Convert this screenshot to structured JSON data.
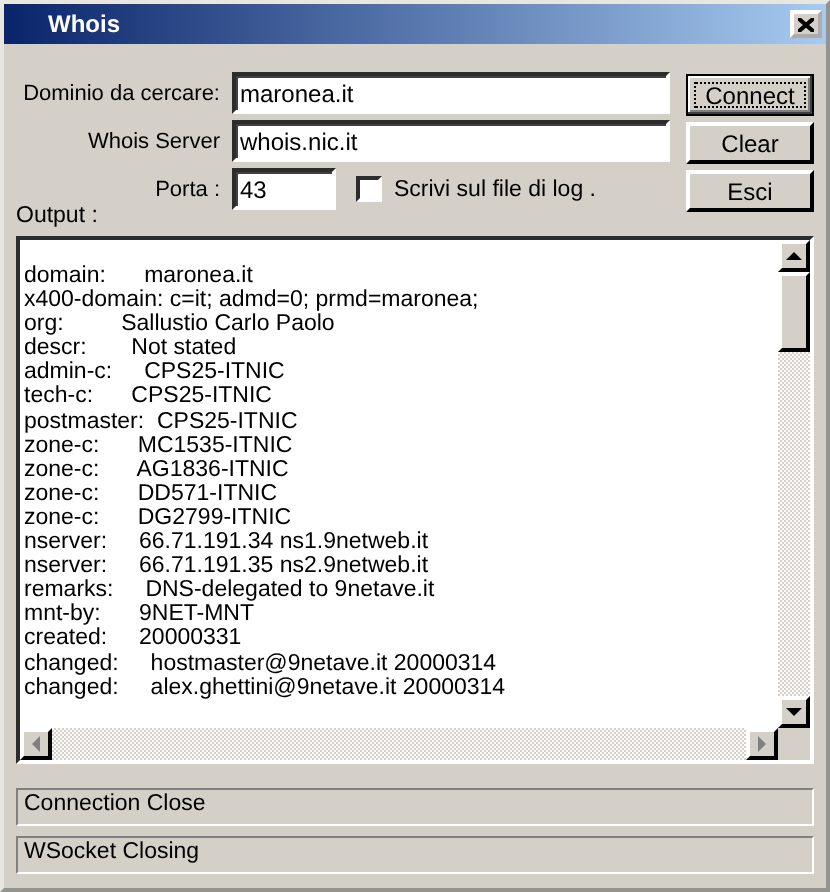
{
  "window": {
    "title": "Whois"
  },
  "fields": [
    {
      "label": "Dominio da cercare:",
      "value": "maronea.it"
    },
    {
      "label": "Whois Server",
      "value": "whois.nic.it"
    }
  ],
  "port": {
    "label": "Porta :",
    "value": "43"
  },
  "log_checkbox": {
    "label": "Scrivi sul file di log .",
    "checked": false
  },
  "buttons": [
    {
      "label": "Connect",
      "focused": true
    },
    {
      "label": "Clear",
      "focused": false
    },
    {
      "label": "Esci",
      "focused": false
    }
  ],
  "output": {
    "label": "Output :",
    "lines": [
      "domain:      maronea.it",
      "x400-domain: c=it; admd=0; prmd=maronea;",
      "org:         Sallustio Carlo Paolo",
      "descr:       Not stated",
      "admin-c:     CPS25-ITNIC",
      "tech-c:      CPS25-ITNIC",
      "postmaster:  CPS25-ITNIC",
      "zone-c:      MC1535-ITNIC",
      "zone-c:      AG1836-ITNIC",
      "zone-c:      DD571-ITNIC",
      "zone-c:      DG2799-ITNIC",
      "nserver:     66.71.191.34 ns1.9netweb.it",
      "nserver:     66.71.191.35 ns2.9netweb.it",
      "remarks:     DNS-delegated to 9netave.it",
      "mnt-by:      9NET-MNT",
      "created:     20000331",
      "changed:     hostmaster@9netave.it 20000314",
      "changed:     alex.ghettini@9netave.it 20000314"
    ]
  },
  "status_lines": [
    "Connection Close",
    "WSocket Closing"
  ]
}
